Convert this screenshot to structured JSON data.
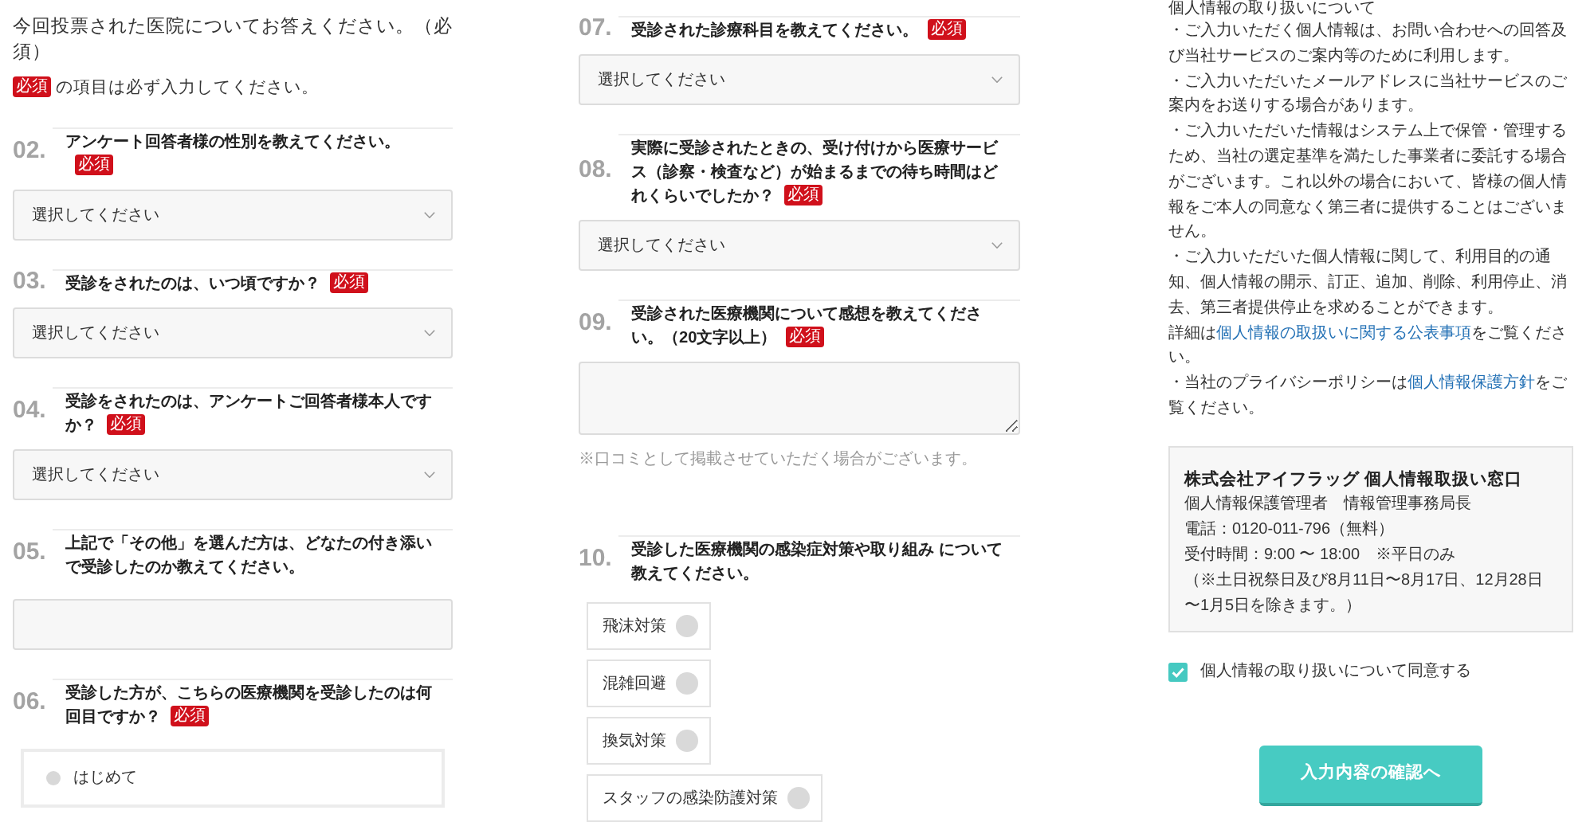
{
  "left_panel": {
    "intro_text": "今回投票された医院についてお答えください。（必須）",
    "required_note": {
      "badge": "必須",
      "text": "の項目は必ず入力してください。"
    },
    "questions": [
      {
        "number": "02.",
        "text": "アンケート回答者様の性別を教えてください。",
        "badge": "必須",
        "field": {
          "kind": "select",
          "placeholder": "選択してください"
        }
      },
      {
        "number": "03.",
        "text": "受診をされたのは、いつ頃ですか？",
        "badge": "必須",
        "field": {
          "kind": "select",
          "placeholder": "選択してください"
        }
      },
      {
        "number": "04.",
        "text": "受診をされたのは、アンケートご回答者様本人ですか？",
        "badge": "必須",
        "field": {
          "kind": "select",
          "placeholder": "選択してください"
        }
      },
      {
        "number": "05.",
        "text": "上記で「その他」を選んだ方は、どなたの付き添いで受診したのか教えてください。",
        "field": {
          "kind": "text"
        }
      },
      {
        "number": "06.",
        "text": "受診した方が、こちらの医療機関を受診したのは何回目ですか？",
        "badge": "必須",
        "field": {
          "kind": "radio",
          "options": [
            {
              "label": "はじめて",
              "selected": false
            }
          ]
        }
      }
    ]
  },
  "middle_panel": {
    "questions": [
      {
        "number": "07.",
        "text": "受診された診療科目を教えてください。",
        "badge": "必須",
        "field": {
          "kind": "select",
          "placeholder": "選択してください"
        }
      },
      {
        "number": "08.",
        "text": "実際に受診されたときの、受け付けから医療サービス（診察・検査など）が始まるまでの待ち時間はどれくらいでしたか？",
        "badge": "必須",
        "field": {
          "kind": "select",
          "placeholder": "選択してください"
        }
      },
      {
        "number": "09.",
        "text": "受診された医療機関について感想を教えてください。（20文字以上）",
        "badge": "必須",
        "field": {
          "kind": "textarea"
        },
        "note": "※口コミとして掲載させていただく場合がございます。"
      },
      {
        "number": "10.",
        "text": "受診した医療機関の感染症対策や取り組み について教えてください。",
        "field": {
          "kind": "checkbox",
          "options": [
            {
              "label": "飛沫対策",
              "checked": false
            },
            {
              "label": "混雑回避",
              "checked": false
            },
            {
              "label": "換気対策",
              "checked": false
            },
            {
              "label": "スタッフの感染防護対策",
              "checked": false
            }
          ]
        }
      }
    ]
  },
  "right_panel": {
    "heading": "個人情報の取り扱いについて",
    "paragraphs": [
      {
        "segments": [
          {
            "kind": "text",
            "text": "・ご入力いただく個人情報は、お問い合わせへの回答及び当社サービスのご案内等のために利用します。"
          }
        ]
      },
      {
        "segments": [
          {
            "kind": "text",
            "text": "・ご入力いただいたメールアドレスに当社サービスのご案内をお送りする場合があります。"
          }
        ]
      },
      {
        "segments": [
          {
            "kind": "text",
            "text": "・ご入力いただいた情報はシステム上で保管・管理するため、当社の選定基準を満たした事業者に委託する場合がございます。これ以外の場合において、皆様の個人情報をご本人の同意なく第三者に提供することはございません。"
          }
        ]
      },
      {
        "segments": [
          {
            "kind": "text",
            "text": "・ご入力いただいた個人情報に関して、利用目的の通知、個人情報の開示、訂正、追加、削除、利用停止、消去、第三者提供停止を求めることができます。"
          }
        ]
      },
      {
        "segments": [
          {
            "kind": "text",
            "text": "詳細は"
          },
          {
            "kind": "link",
            "text": "個人情報の取扱いに関する公表事項"
          },
          {
            "kind": "text",
            "text": "をご覧ください。"
          }
        ]
      },
      {
        "segments": [
          {
            "kind": "text",
            "text": "・当社のプライバシーポリシーは"
          },
          {
            "kind": "link",
            "text": "個人情報保護方針"
          },
          {
            "kind": "text",
            "text": "をご覧ください。"
          }
        ]
      }
    ],
    "contact_box": {
      "title": "株式会社アイフラッグ 個人情報取扱い窓口",
      "lines": [
        "個人情報保護管理者　情報管理事務局長",
        "電話：0120-011-796（無料）",
        "受付時間：9:00 〜 18:00　※平日のみ",
        "（※土日祝祭日及び8月11日〜8月17日、12月28日〜1月5日を除きます。）"
      ]
    },
    "consent": {
      "label": "個人情報の取り扱いについて同意する",
      "checked": true
    },
    "submit_button": "入力内容の確認へ"
  }
}
